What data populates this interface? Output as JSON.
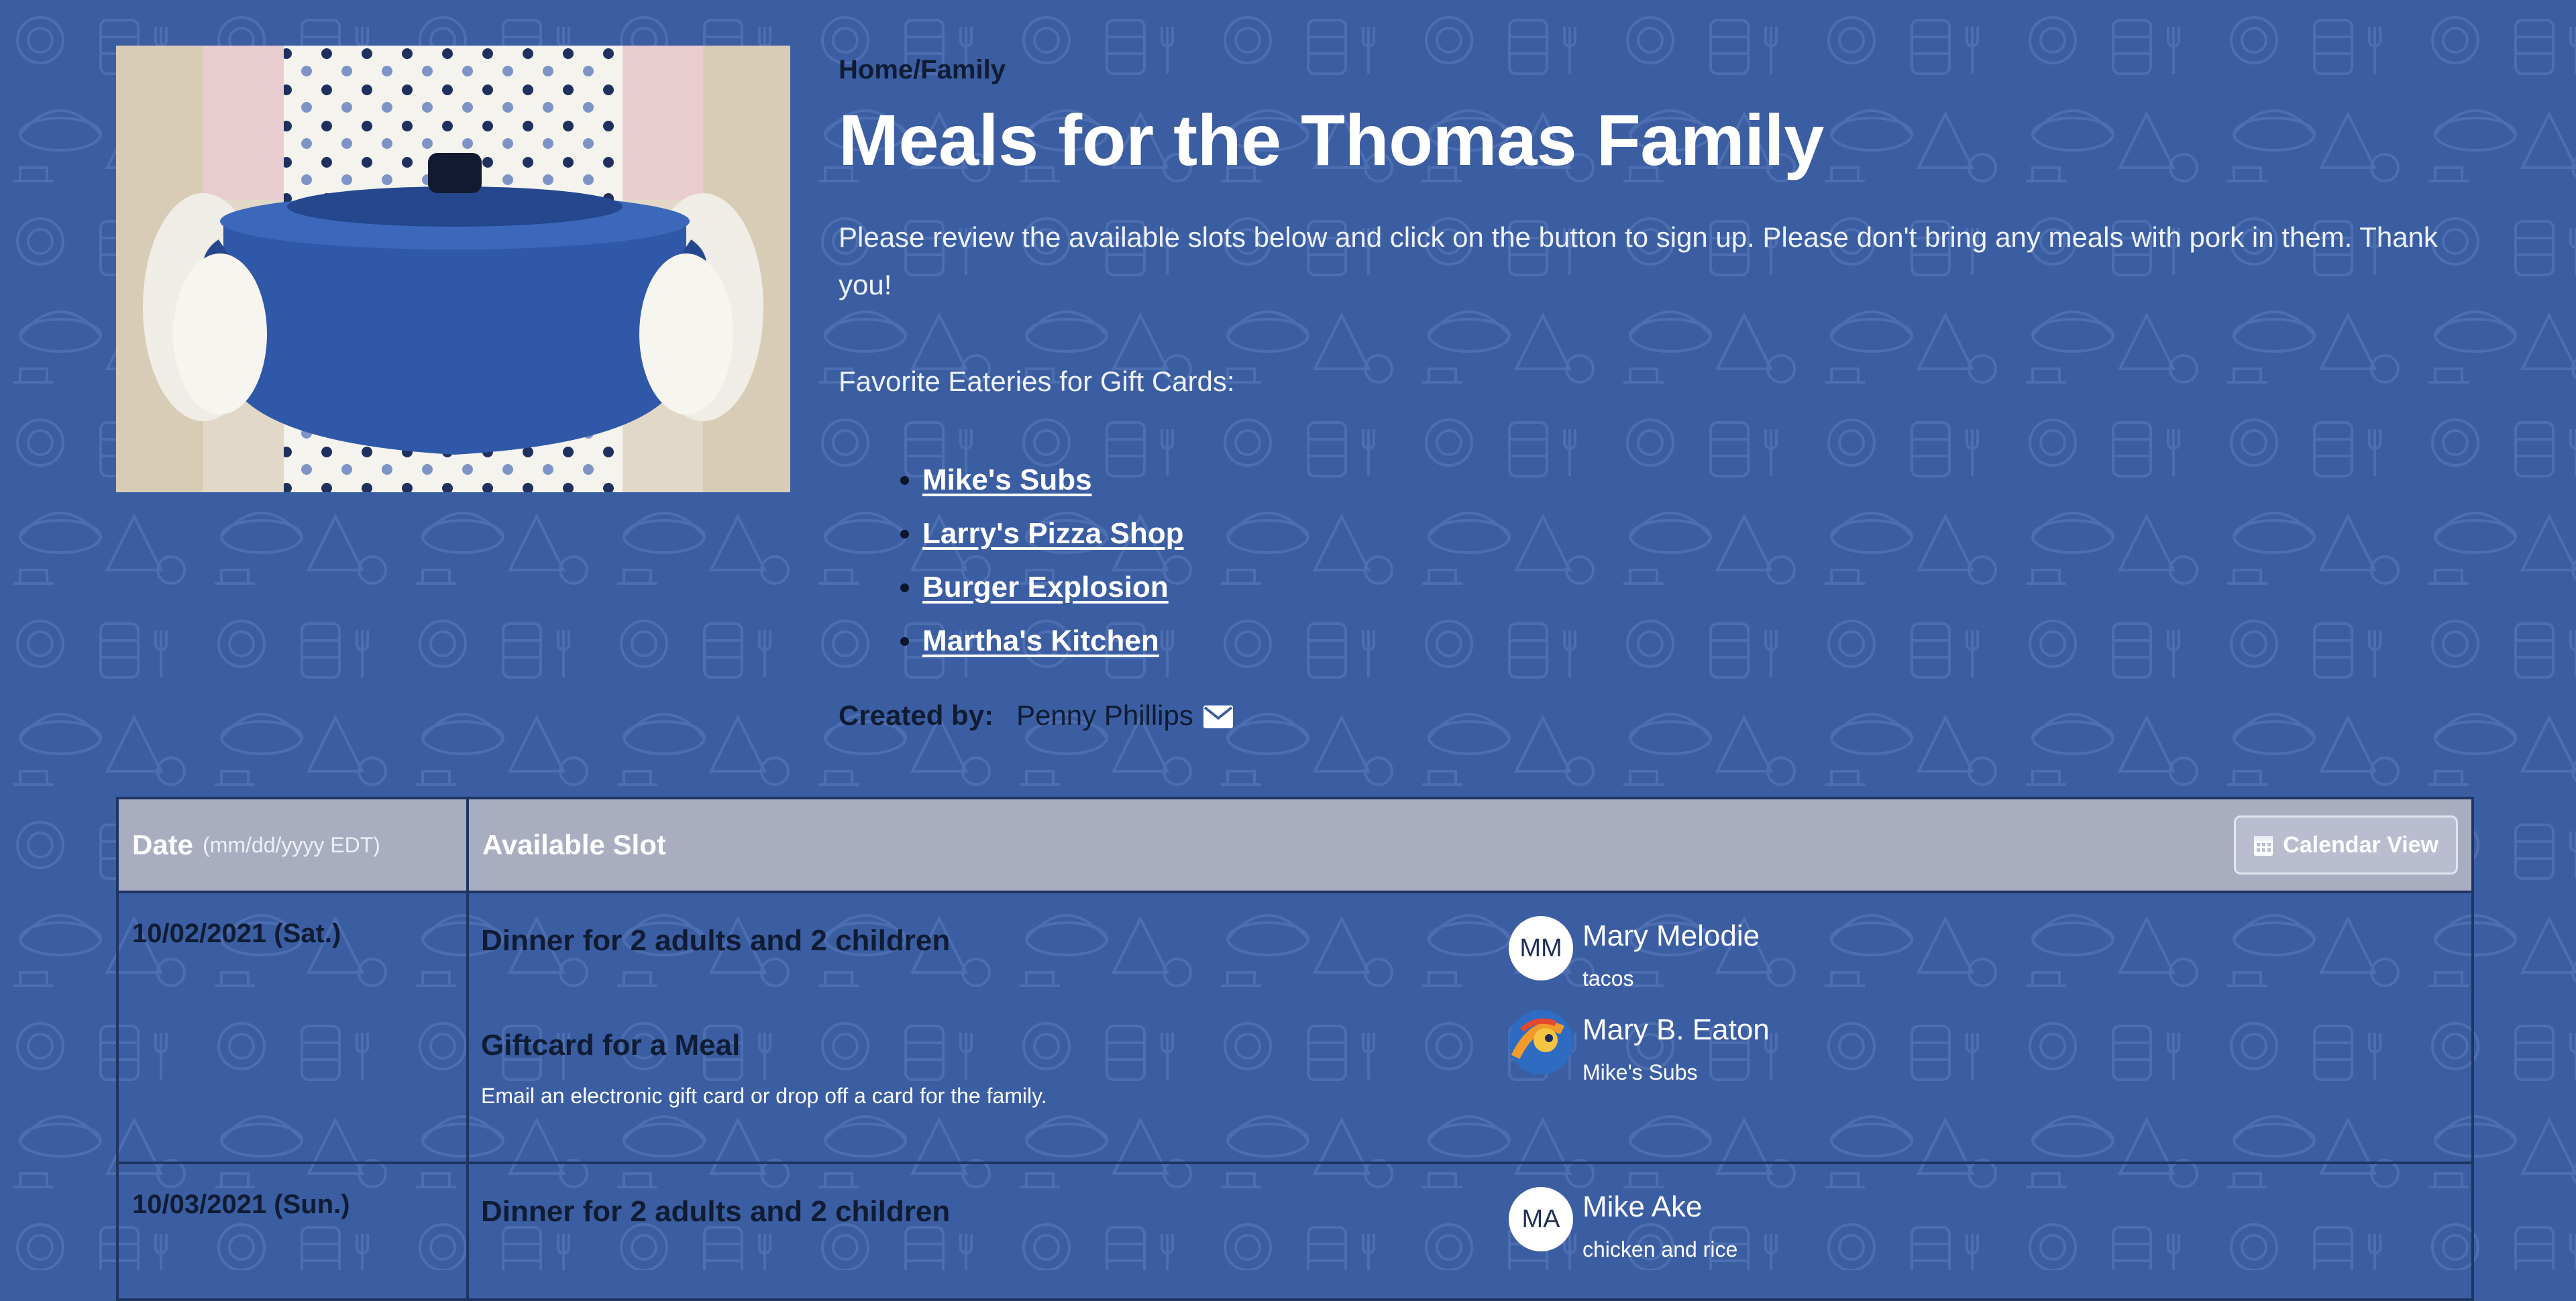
{
  "breadcrumb": "Home/Family",
  "title": "Meals for the Thomas Family",
  "intro": "Please review the available slots below and click on the button to sign up. Please don't bring any meals with pork in them. Thank you!",
  "eateries_heading": "Favorite Eateries for Gift Cards:",
  "eateries": [
    "Mike's Subs",
    "Larry's Pizza Shop",
    "Burger Explosion",
    "Martha's Kitchen"
  ],
  "created_by": {
    "label": "Created by:",
    "name": "Penny Phillips",
    "icon": "mail-icon"
  },
  "table": {
    "date_header": "Date",
    "date_header_sub": "(mm/dd/yyyy EDT)",
    "slot_header": "Available Slot",
    "calendar_button": "Calendar View",
    "calendar_icon": "calendar-icon",
    "rows": [
      {
        "date": "10/02/2021 (Sat.)",
        "slots": [
          {
            "name": "Dinner for 2 adults and 2 children",
            "description": "",
            "person": {
              "initials": "MM",
              "name": "Mary Melodie",
              "note": "tacos",
              "avatar": "initials"
            }
          },
          {
            "name": "Giftcard for a Meal",
            "description": "Email an electronic gift card or drop off a card for the family.",
            "person": {
              "initials": "",
              "name": "Mary B. Eaton",
              "note": "Mike's Subs",
              "avatar": "photo"
            }
          }
        ]
      },
      {
        "date": "10/03/2021 (Sun.)",
        "slots": [
          {
            "name": "Dinner for 2 adults and 2 children",
            "description": "",
            "person": {
              "initials": "MA",
              "name": "Mike Ake",
              "note": "chicken and rice",
              "avatar": "initials"
            }
          }
        ]
      }
    ]
  },
  "colors": {
    "background": "#3b5ea3",
    "table_header": "#a9adc0",
    "dark_text": "#101c33",
    "pot_blue": "#2f58a8"
  }
}
